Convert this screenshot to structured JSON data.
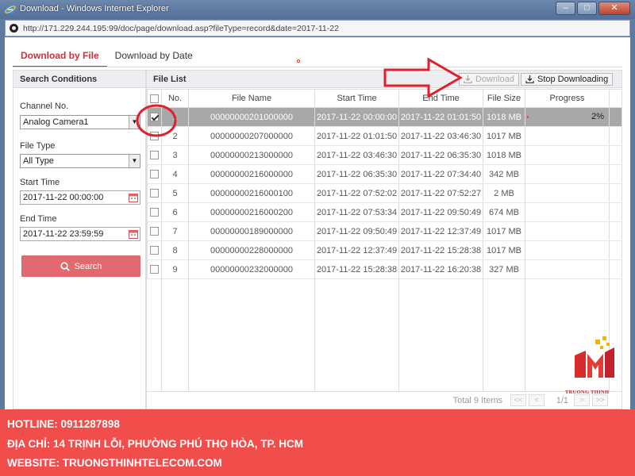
{
  "window": {
    "title": "Download - Windows Internet Explorer",
    "url": "http://171.229.244.195:99/doc/page/download.asp?fileType=record&date=2017-11-22",
    "buttons": {
      "minimize": "–",
      "maximize": "□",
      "close": "✕"
    }
  },
  "tabs": [
    {
      "label": "Download by File",
      "active": true
    },
    {
      "label": "Download by Date",
      "active": false
    }
  ],
  "search_conditions": {
    "title": "Search Conditions",
    "channel_label": "Channel No.",
    "channel_value": "Analog Camera1",
    "filetype_label": "File Type",
    "filetype_value": "All Type",
    "start_label": "Start Time",
    "start_value": "2017-11-22 00:00:00",
    "end_label": "End Time",
    "end_value": "2017-11-22 23:59:59",
    "search_button": "Search"
  },
  "file_list": {
    "title": "File List",
    "download_button": "Download",
    "stop_button": "Stop Downloading",
    "columns": [
      "No.",
      "File Name",
      "Start Time",
      "End Time",
      "File Size",
      "Progress"
    ],
    "rows": [
      {
        "no": "1",
        "name": "00000000201000000",
        "start": "2017-11-22 00:00:00",
        "end": "2017-11-22 01:01:50",
        "size": "1018 MB",
        "progress": "2%",
        "progress_value": 0.02,
        "checked": true,
        "selected": true
      },
      {
        "no": "2",
        "name": "00000000207000000",
        "start": "2017-11-22 01:01:50",
        "end": "2017-11-22 03:46:30",
        "size": "1017 MB",
        "progress": "",
        "checked": false,
        "selected": false
      },
      {
        "no": "3",
        "name": "00000000213000000",
        "start": "2017-11-22 03:46:30",
        "end": "2017-11-22 06:35:30",
        "size": "1018 MB",
        "progress": "",
        "checked": false,
        "selected": false
      },
      {
        "no": "4",
        "name": "00000000216000000",
        "start": "2017-11-22 06:35:30",
        "end": "2017-11-22 07:34:40",
        "size": "342 MB",
        "progress": "",
        "checked": false,
        "selected": false
      },
      {
        "no": "5",
        "name": "00000000216000100",
        "start": "2017-11-22 07:52:02",
        "end": "2017-11-22 07:52:27",
        "size": "2 MB",
        "progress": "",
        "checked": false,
        "selected": false
      },
      {
        "no": "6",
        "name": "00000000216000200",
        "start": "2017-11-22 07:53:34",
        "end": "2017-11-22 09:50:49",
        "size": "674 MB",
        "progress": "",
        "checked": false,
        "selected": false
      },
      {
        "no": "7",
        "name": "00000000189000000",
        "start": "2017-11-22 09:50:49",
        "end": "2017-11-22 12:37:49",
        "size": "1017 MB",
        "progress": "",
        "checked": false,
        "selected": false
      },
      {
        "no": "8",
        "name": "00000000228000000",
        "start": "2017-11-22 12:37:49",
        "end": "2017-11-22 15:28:38",
        "size": "1017 MB",
        "progress": "",
        "checked": false,
        "selected": false
      },
      {
        "no": "9",
        "name": "00000000232000000",
        "start": "2017-11-22 15:28:38",
        "end": "2017-11-22 16:20:38",
        "size": "327 MB",
        "progress": "",
        "checked": false,
        "selected": false
      }
    ],
    "total": "Total 9 Items",
    "page": "1/1",
    "pager": {
      "first": "<<",
      "prev": "<",
      "next": ">",
      "last": ">>"
    }
  },
  "logo": {
    "text": "TRUONG THINH"
  },
  "banner": {
    "hotline": "HOTLINE: 0911287898",
    "address": "ĐỊA CHỈ: 14 TRỊNH LỖI, PHƯỜNG PHÚ THỌ HÒA, TP. HCM",
    "website": "WEBSITE: TRUONGTHINHTELECOM.COM"
  },
  "colors": {
    "accent": "#c8333a",
    "search_button": "#e06a6d",
    "banner": "#f04d4b",
    "selected_row": "#a8a8a8",
    "annotation": "#e0202a"
  }
}
